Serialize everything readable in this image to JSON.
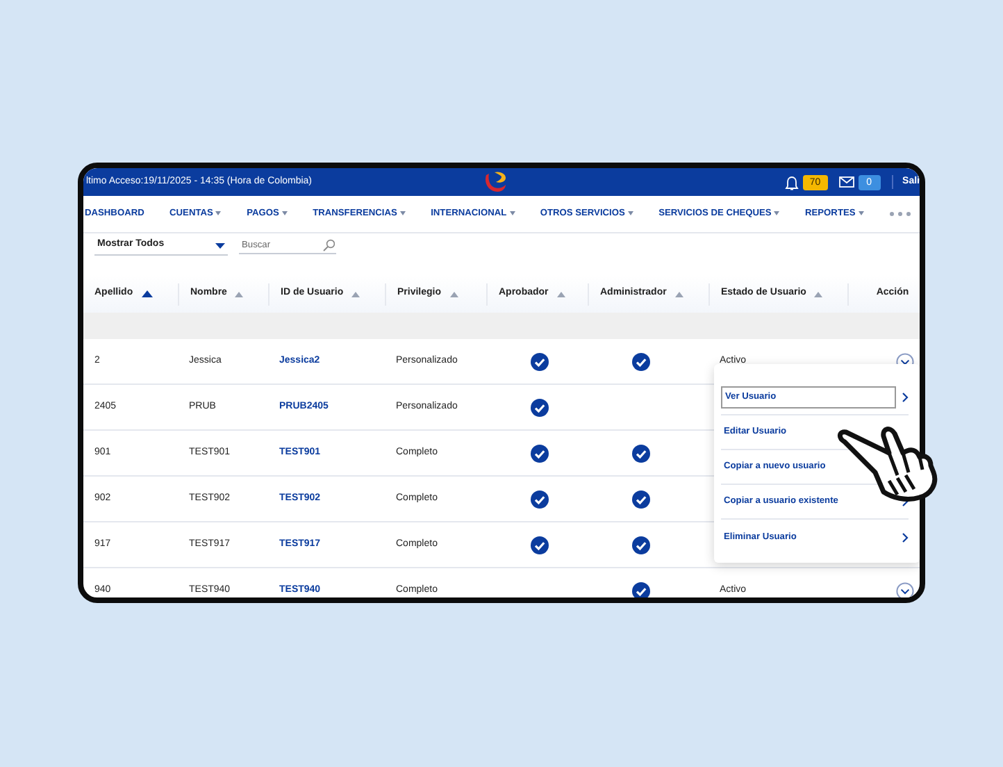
{
  "top_bar": {
    "last_access": "ltimo Acceso:19/11/2025 - 14:35 (Hora de Colombia)",
    "notifications": "70",
    "messages": "0",
    "logout": "Sali"
  },
  "nav": [
    {
      "label": "DASHBOARD",
      "dropdown": false
    },
    {
      "label": "CUENTAS",
      "dropdown": true
    },
    {
      "label": "PAGOS",
      "dropdown": true
    },
    {
      "label": "TRANSFERENCIAS",
      "dropdown": true
    },
    {
      "label": "INTERNACIONAL",
      "dropdown": true
    },
    {
      "label": "OTROS SERVICIOS",
      "dropdown": true
    },
    {
      "label": "SERVICIOS DE CHEQUES",
      "dropdown": true
    },
    {
      "label": "REPORTES",
      "dropdown": true
    }
  ],
  "filter": {
    "value": "Mostrar Todos"
  },
  "search": {
    "placeholder": "Buscar"
  },
  "table": {
    "columns": [
      {
        "label": "Apellido",
        "sorted": true
      },
      {
        "label": "Nombre",
        "sorted": false
      },
      {
        "label": "ID de Usuario",
        "sorted": false
      },
      {
        "label": "Privilegio",
        "sorted": false
      },
      {
        "label": "Aprobador",
        "sorted": false
      },
      {
        "label": "Administrador",
        "sorted": false
      },
      {
        "label": "Estado de Usuario",
        "sorted": false
      },
      {
        "label": "Acción"
      }
    ],
    "rows": [
      {
        "apellido": "2",
        "nombre": "Jessica",
        "id": "Jessica2",
        "privilegio": "Personalizado",
        "aprobador": true,
        "administrador": true,
        "status": "Activo"
      },
      {
        "apellido": "2405",
        "nombre": "PRUB",
        "id": "PRUB2405",
        "privilegio": "Personalizado",
        "aprobador": true,
        "administrador": false
      },
      {
        "apellido": "901",
        "nombre": "TEST901",
        "id": "TEST901",
        "privilegio": "Completo",
        "aprobador": true,
        "administrador": true
      },
      {
        "apellido": "902",
        "nombre": "TEST902",
        "id": "TEST902",
        "privilegio": "Completo",
        "aprobador": true,
        "administrador": true
      },
      {
        "apellido": "917",
        "nombre": "TEST917",
        "id": "TEST917",
        "privilegio": "Completo",
        "aprobador": true,
        "administrador": true
      },
      {
        "apellido": "940",
        "nombre": "TEST940",
        "id": "TEST940",
        "privilegio": "Completo",
        "aprobador": false,
        "administrador": true,
        "status": "Activo"
      }
    ]
  },
  "action_menu": [
    {
      "label": "Ver Usuario",
      "selected": true,
      "arrow": true
    },
    {
      "label": "Editar Usuario",
      "selected": false,
      "arrow": false
    },
    {
      "label": "Copiar a nuevo usuario",
      "selected": false,
      "arrow": false
    },
    {
      "label": "Copiar a usuario existente",
      "selected": false,
      "arrow": true
    },
    {
      "label": "Eliminar Usuario",
      "selected": false,
      "arrow": true
    }
  ]
}
